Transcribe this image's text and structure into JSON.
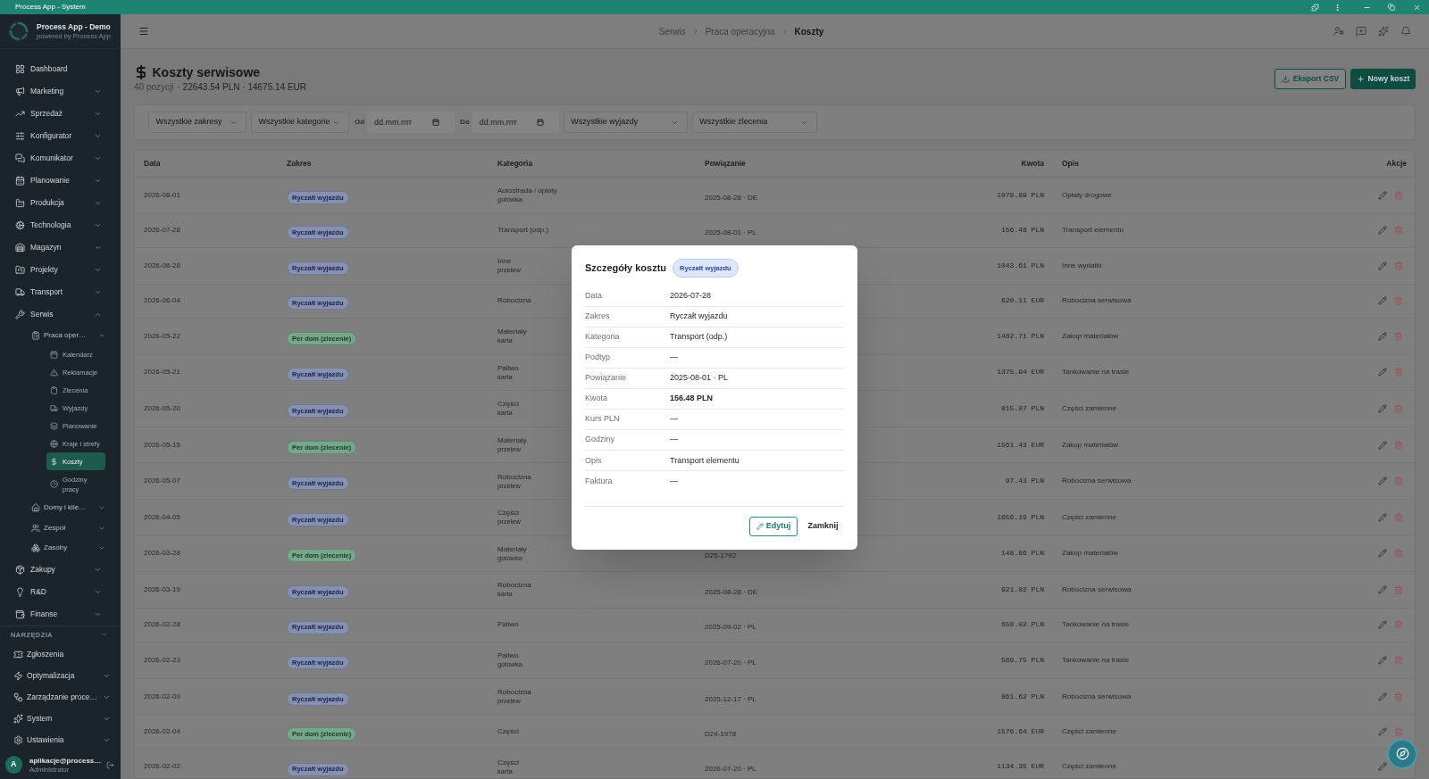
{
  "title_bar": {
    "title": "Process App - System"
  },
  "sidebar": {
    "brand": {
      "name": "Process App - Demo",
      "tagline": "powered by Process App"
    },
    "items": [
      {
        "label": "Dashboard",
        "selected": false
      },
      {
        "label": "Marketing",
        "selected": false,
        "expanded": false
      },
      {
        "label": "Sprzedaż",
        "selected": false,
        "expanded": false
      },
      {
        "label": "Konfigurator",
        "selected": false,
        "expanded": false
      },
      {
        "label": "Komunikator",
        "selected": false,
        "expanded": false
      },
      {
        "label": "Planowanie",
        "selected": false,
        "expanded": false
      },
      {
        "label": "Produkcja",
        "selected": false,
        "expanded": false
      },
      {
        "label": "Technologia",
        "selected": false,
        "expanded": false
      },
      {
        "label": "Magazyn",
        "selected": false,
        "expanded": false
      },
      {
        "label": "Projekty",
        "selected": false,
        "expanded": false
      },
      {
        "label": "Transport",
        "selected": false,
        "expanded": false
      },
      {
        "label": "Serwis",
        "selected": false,
        "expanded": true,
        "children": [
          {
            "label": "Praca oper…",
            "selected": false,
            "expanded": true,
            "children": [
              {
                "label": "Kalendarz",
                "selected": false
              },
              {
                "label": "Reklamacje",
                "selected": false
              },
              {
                "label": "Zlecenia",
                "selected": false
              },
              {
                "label": "Wyjazdy",
                "selected": false
              },
              {
                "label": "Planowanie",
                "selected": false
              },
              {
                "label": "Kraje i strefy",
                "selected": false
              },
              {
                "label": "Koszty",
                "selected": true
              },
              {
                "label": "Godziny pracy",
                "selected": false
              }
            ]
          },
          {
            "label": "Domy i klie…",
            "selected": false,
            "expanded": false
          },
          {
            "label": "Zespół",
            "selected": false,
            "expanded": false
          },
          {
            "label": "Zasoby",
            "selected": false,
            "expanded": false
          }
        ]
      },
      {
        "label": "Zakupy",
        "selected": false,
        "expanded": false
      },
      {
        "label": "R&D",
        "selected": false,
        "expanded": false
      },
      {
        "label": "Finanse",
        "selected": false,
        "expanded": false
      }
    ],
    "tools": {
      "title": "NARZĘDZIA",
      "expanded": true,
      "items": [
        {
          "label": "Zgłoszenia",
          "selected": false
        },
        {
          "label": "Optymalizacja",
          "selected": false,
          "expanded": false
        },
        {
          "label": "Zarządzanie proce…",
          "selected": false,
          "expanded": false
        },
        {
          "label": "System",
          "selected": false,
          "expanded": false
        },
        {
          "label": "Ustawienia",
          "selected": false,
          "expanded": false
        }
      ]
    },
    "user": {
      "initial": "A",
      "email": "aplikacje@process…",
      "role": "Administrator"
    }
  },
  "header": {
    "breadcrumb": [
      {
        "label": "Serwis",
        "current": false
      },
      {
        "label": "Praca operacyjna",
        "current": false
      },
      {
        "label": "Koszty",
        "current": true
      }
    ]
  },
  "page": {
    "title": "Koszty serwisowe",
    "count": "40 pozycji",
    "totals": "· 22643.54 PLN · 14675.14 EUR",
    "actions": [
      {
        "label": "Eksport CSV",
        "kind": "outline"
      },
      {
        "label": "Nowy koszt",
        "kind": "primary"
      }
    ]
  },
  "filters": [
    {
      "kind": "select",
      "value": "Wszystkie zakresy"
    },
    {
      "kind": "select",
      "value": "Wszystkie kategorie"
    },
    {
      "kind": "date",
      "label": "Od",
      "placeholder": "dd.mm.rrrr"
    },
    {
      "kind": "date",
      "label": "Do",
      "placeholder": "dd.mm.rrrr"
    },
    {
      "kind": "select",
      "value": "Wszystkie wyjazdy"
    },
    {
      "kind": "select",
      "value": "Wszystkie zlecenia"
    }
  ],
  "table": {
    "columns": [
      "Data",
      "Zakres",
      "Kategoria",
      "Powiązanie",
      "Kwota",
      "Opis",
      "Akcje"
    ],
    "rows": [
      {
        "date": "2026-08-01",
        "scope": {
          "label": "Ryczałt wyjazdu",
          "kind": "trip"
        },
        "category": "Autostrada / opłaty",
        "payment": "gotówka",
        "link": "2025-08-28 · DE",
        "amount": "1079.89 PLN",
        "description": "Opłaty drogowe",
        "actions": [
          {
            "kind": "edit"
          },
          {
            "kind": "delete"
          }
        ]
      },
      {
        "date": "2026-07-28",
        "scope": {
          "label": "Ryczałt wyjazdu",
          "kind": "trip"
        },
        "category": "Transport (odp.)",
        "link": "2025-08-01 · PL",
        "amount": "156.48 PLN",
        "description": "Transport elementu",
        "actions": [
          {
            "kind": "edit"
          },
          {
            "kind": "delete"
          }
        ]
      },
      {
        "date": "2026-06-28",
        "scope": {
          "label": "Ryczałt wyjazdu",
          "kind": "trip"
        },
        "category": "Inne",
        "payment": "przelew",
        "amount": "1043.61 PLN",
        "description": "Inne wydatki",
        "actions": [
          {
            "kind": "edit"
          },
          {
            "kind": "delete"
          }
        ]
      },
      {
        "date": "2026-06-04",
        "scope": {
          "label": "Ryczałt wyjazdu",
          "kind": "trip"
        },
        "category": "Robocizna",
        "amount": "620.11 EUR",
        "description": "Robocizna serwisowa",
        "actions": [
          {
            "kind": "edit"
          },
          {
            "kind": "delete"
          }
        ]
      },
      {
        "date": "2026-05-22",
        "scope": {
          "label": "Per dom (zlecenie)",
          "kind": "house"
        },
        "category": "Materiały",
        "payment": "karta",
        "amount": "1482.71 PLN",
        "description": "Zakup materiałów",
        "actions": [
          {
            "kind": "edit"
          },
          {
            "kind": "delete"
          }
        ]
      },
      {
        "date": "2026-05-21",
        "scope": {
          "label": "Ryczałt wyjazdu",
          "kind": "trip"
        },
        "category": "Paliwo",
        "payment": "karta",
        "amount": "1375.94 EUR",
        "description": "Tankowanie na trasie",
        "actions": [
          {
            "kind": "edit"
          },
          {
            "kind": "delete"
          }
        ]
      },
      {
        "date": "2026-05-20",
        "scope": {
          "label": "Ryczałt wyjazdu",
          "kind": "trip"
        },
        "category": "Części",
        "payment": "karta",
        "amount": "815.07 PLN",
        "description": "Części zamienne",
        "actions": [
          {
            "kind": "edit"
          },
          {
            "kind": "delete"
          }
        ]
      },
      {
        "date": "2026-05-15",
        "scope": {
          "label": "Per dom (zlecenie)",
          "kind": "house"
        },
        "category": "Materiały",
        "payment": "przelew",
        "amount": "1561.43 EUR",
        "description": "Zakup materiałów",
        "actions": [
          {
            "kind": "edit"
          },
          {
            "kind": "delete"
          }
        ]
      },
      {
        "date": "2026-05-07",
        "scope": {
          "label": "Ryczałt wyjazdu",
          "kind": "trip"
        },
        "category": "Robocizna",
        "payment": "przelew",
        "amount": "97.43 PLN",
        "description": "Robocizna serwisowa",
        "actions": [
          {
            "kind": "edit"
          },
          {
            "kind": "delete"
          }
        ]
      },
      {
        "date": "2026-04-05",
        "scope": {
          "label": "Ryczałt wyjazdu",
          "kind": "trip"
        },
        "category": "Części",
        "payment": "przelew",
        "amount": "1656.19 PLN",
        "description": "Części zamienne",
        "actions": [
          {
            "kind": "edit"
          },
          {
            "kind": "delete"
          }
        ]
      },
      {
        "date": "2026-03-28",
        "scope": {
          "label": "Per dom (zlecenie)",
          "kind": "house"
        },
        "category": "Materiały",
        "payment": "gotówka",
        "link": "D25-1792",
        "amount": "148.86 PLN",
        "description": "Zakup materiałów",
        "actions": [
          {
            "kind": "edit"
          },
          {
            "kind": "delete"
          }
        ]
      },
      {
        "date": "2026-03-19",
        "scope": {
          "label": "Ryczałt wyjazdu",
          "kind": "trip"
        },
        "category": "Robocizna",
        "payment": "karta",
        "link": "2025-08-28 · DE",
        "amount": "921.02 PLN",
        "description": "Robocizna serwisowa",
        "actions": [
          {
            "kind": "edit"
          },
          {
            "kind": "delete"
          }
        ]
      },
      {
        "date": "2026-02-28",
        "scope": {
          "label": "Ryczałt wyjazdu",
          "kind": "trip"
        },
        "category": "Paliwo",
        "link": "2025-09-02 · PL",
        "amount": "659.02 PLN",
        "description": "Tankowanie na trasie",
        "actions": [
          {
            "kind": "edit"
          },
          {
            "kind": "delete"
          }
        ]
      },
      {
        "date": "2026-02-23",
        "scope": {
          "label": "Ryczałt wyjazdu",
          "kind": "trip"
        },
        "category": "Paliwo",
        "payment": "gotówka",
        "link": "2026-07-20 · PL",
        "amount": "589.75 PLN",
        "description": "Tankowanie na trasie",
        "actions": [
          {
            "kind": "edit"
          },
          {
            "kind": "delete"
          }
        ]
      },
      {
        "date": "2026-02-09",
        "scope": {
          "label": "Ryczałt wyjazdu",
          "kind": "trip"
        },
        "category": "Robocizna",
        "payment": "przelew",
        "link": "2025-12-17 · PL",
        "amount": "861.62 PLN",
        "description": "Robocizna serwisowa",
        "actions": [
          {
            "kind": "edit"
          },
          {
            "kind": "delete"
          }
        ]
      },
      {
        "date": "2026-02-04",
        "scope": {
          "label": "Per dom (zlecenie)",
          "kind": "house"
        },
        "category": "Części",
        "link": "D24-1978",
        "amount": "1576.64 EUR",
        "description": "Części zamienne",
        "actions": [
          {
            "kind": "edit"
          },
          {
            "kind": "delete"
          }
        ]
      },
      {
        "date": "2026-02-02",
        "scope": {
          "label": "Ryczałt wyjazdu",
          "kind": "trip"
        },
        "category": "Części",
        "payment": "karta",
        "link": "2026-07-20 · PL",
        "amount": "1134.35 EUR",
        "description": "Części zamienne",
        "actions": [
          {
            "kind": "edit"
          }
        ]
      }
    ]
  },
  "dialog": {
    "title": "Szczegóły kosztu",
    "badge": {
      "label": "Ryczałt wyjazdu",
      "kind": "trip"
    },
    "fields": [
      {
        "label": "Data",
        "value": "2026-07-28",
        "strong": false
      },
      {
        "label": "Zakres",
        "value": "Ryczałt wyjazdu",
        "strong": false
      },
      {
        "label": "Kategoria",
        "value": "Transport (odp.)",
        "strong": false
      },
      {
        "label": "Podtyp",
        "value": "—",
        "strong": false
      },
      {
        "label": "Powiązanie",
        "value": "2025-08-01 · PL",
        "strong": false
      },
      {
        "label": "Kwota",
        "value": "156.48 PLN",
        "strong": true
      },
      {
        "label": "Kurs PLN",
        "value": "—",
        "strong": false
      },
      {
        "label": "Godziny",
        "value": "—",
        "strong": false
      },
      {
        "label": "Opis",
        "value": "Transport elementu",
        "strong": false
      },
      {
        "label": "Faktura",
        "value": "—",
        "strong": false
      }
    ],
    "buttons": [
      {
        "label": "Edytuj",
        "kind": "outline"
      },
      {
        "label": "Zamknij",
        "kind": "text"
      }
    ]
  }
}
